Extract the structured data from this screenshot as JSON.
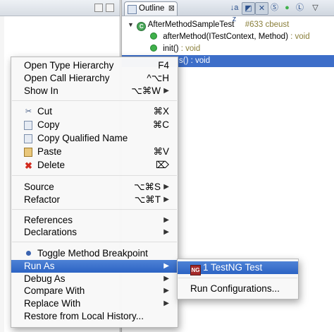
{
  "outline": {
    "tab_title": "Outline",
    "tab_close": "⊠",
    "toolbar": [
      "↓a z",
      "◩",
      "✕",
      "Ⓢ",
      "●",
      "Ⓛ",
      "▽"
    ],
    "tree": {
      "class_name": "AfterMethodSampleTest",
      "class_meta": "#633 cbeust",
      "methods": [
        {
          "name": "afterMethod(ITestContext, Method)",
          "ret": " : void"
        },
        {
          "name": "init()",
          "ret": " : void"
        },
        {
          "name": "s() : void",
          "ret": ""
        }
      ]
    }
  },
  "menu": {
    "items": [
      {
        "label": "Open Type Hierarchy",
        "shortcut": "F4"
      },
      {
        "label": "Open Call Hierarchy",
        "shortcut": "^⌥H"
      },
      {
        "label": "Show In",
        "shortcut": "⌥⌘W"
      },
      {
        "label": "Cut",
        "shortcut": "⌘X",
        "icon": "scissors-icon"
      },
      {
        "label": "Copy",
        "shortcut": "⌘C",
        "icon": "copy-icon"
      },
      {
        "label": "Copy Qualified Name",
        "shortcut": "",
        "icon": "copy-qualified-icon"
      },
      {
        "label": "Paste",
        "shortcut": "⌘V",
        "icon": "paste-icon"
      },
      {
        "label": "Delete",
        "shortcut": "⌦",
        "icon": "delete-icon"
      },
      {
        "label": "Source",
        "shortcut": "⌥⌘S"
      },
      {
        "label": "Refactor",
        "shortcut": "⌥⌘T"
      },
      {
        "label": "References",
        "shortcut": ""
      },
      {
        "label": "Declarations",
        "shortcut": ""
      },
      {
        "label": "Toggle Method Breakpoint",
        "shortcut": "",
        "icon": "breakpoint-icon"
      },
      {
        "label": "Run As",
        "shortcut": ""
      },
      {
        "label": "Debug As",
        "shortcut": ""
      },
      {
        "label": "Compare With",
        "shortcut": ""
      },
      {
        "label": "Replace With",
        "shortcut": ""
      },
      {
        "label": "Restore from Local History...",
        "shortcut": ""
      }
    ]
  },
  "submenu": {
    "items": [
      {
        "label": "1 TestNG Test",
        "icon": "testng-icon"
      },
      {
        "label": "Run Configurations..."
      }
    ]
  },
  "colors": {
    "selection": "#3d6ec9",
    "menu_highlight": "#2c63c4"
  }
}
